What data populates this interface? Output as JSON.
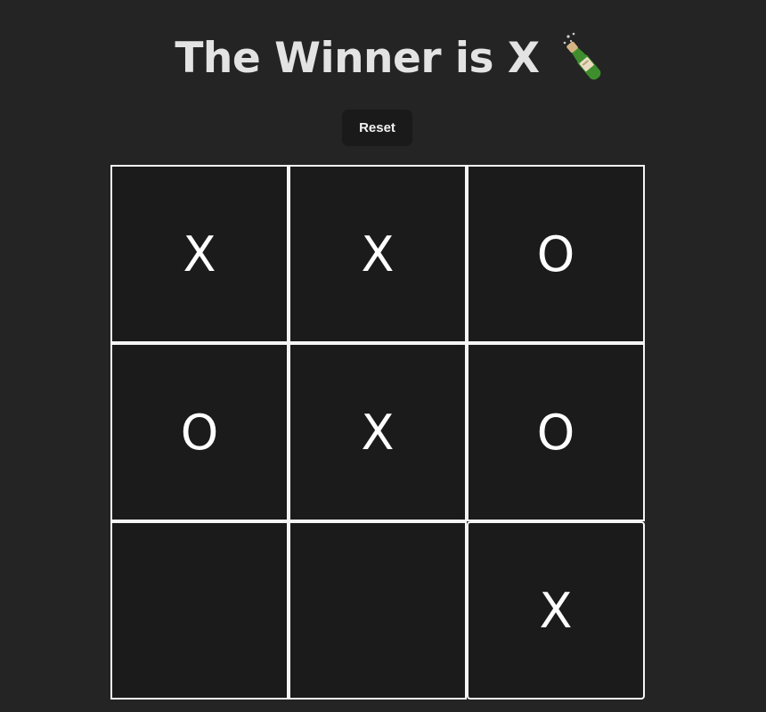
{
  "header": {
    "title": "The Winner is X",
    "celebration_icon": "champagne-bottle-icon"
  },
  "controls": {
    "reset_label": "Reset"
  },
  "board": {
    "cells": [
      "X",
      "X",
      "O",
      "O",
      "X",
      "O",
      "",
      "",
      "X"
    ]
  },
  "colors": {
    "background": "#242424",
    "cell_background": "#1b1b1b",
    "cell_border": "#f5f5f5",
    "title_text": "#e3e3e3",
    "button_background": "#1a1a1a"
  }
}
